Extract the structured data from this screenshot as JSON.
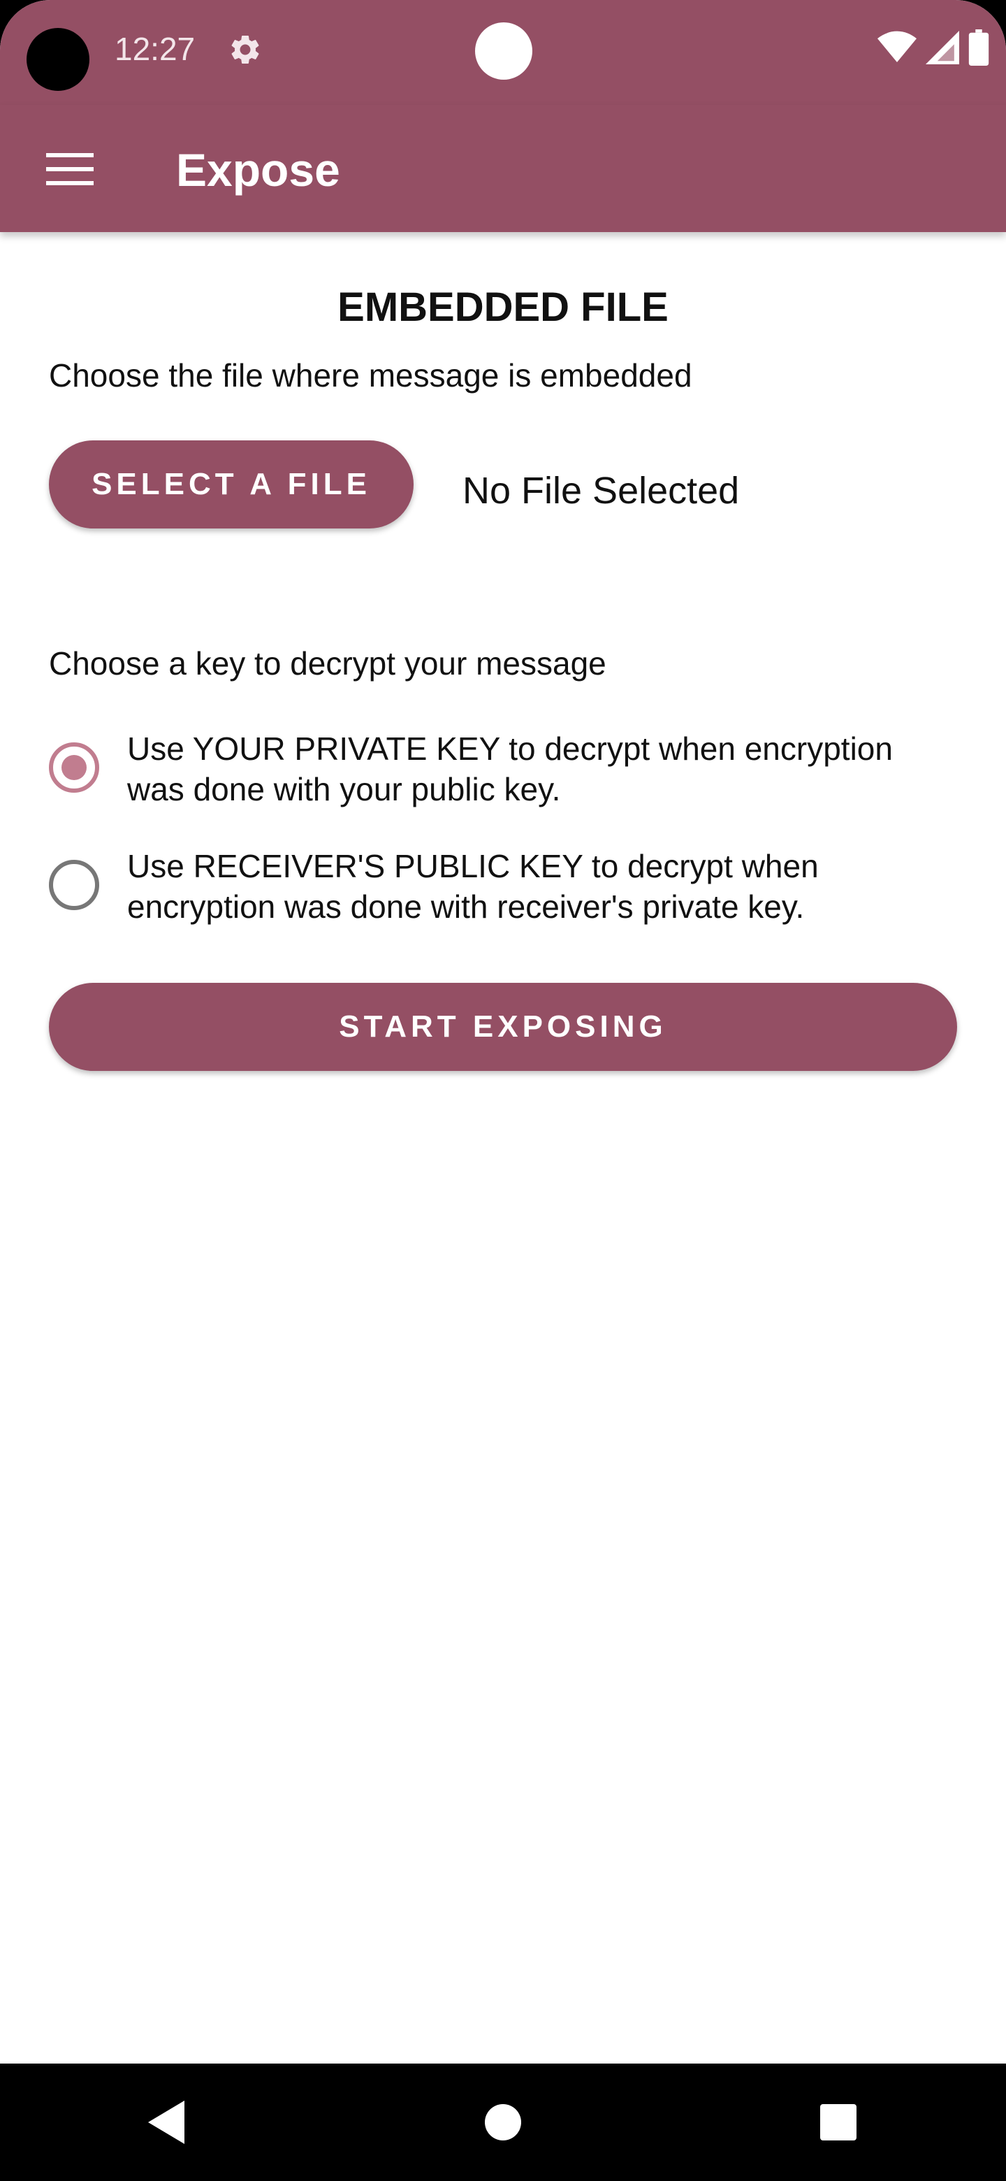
{
  "status_bar": {
    "time": "12:27",
    "icons": [
      "settings-icon",
      "wifi-icon",
      "signal-icon",
      "battery-icon"
    ]
  },
  "app_bar": {
    "title": "Expose",
    "menu_icon": "hamburger-menu-icon"
  },
  "embedded_file": {
    "title": "EMBEDDED FILE",
    "instruction": "Choose the file where message is embedded",
    "select_button_label": "SELECT A FILE",
    "file_status": "No File Selected"
  },
  "key_selection": {
    "instruction": "Choose a key to decrypt your message",
    "options": [
      {
        "label": "Use YOUR PRIVATE KEY to decrypt when encryption was done with your public key.",
        "checked": true
      },
      {
        "label": "Use RECEIVER'S PUBLIC KEY to decrypt when encryption was done with receiver's private key.",
        "checked": false
      }
    ]
  },
  "actions": {
    "start_label": "START EXPOSING"
  },
  "colors": {
    "brand": "#944f64",
    "radio_accent": "#c17d8f"
  },
  "nav_bar": {
    "icons": [
      "back-icon",
      "home-icon",
      "recents-icon"
    ]
  }
}
